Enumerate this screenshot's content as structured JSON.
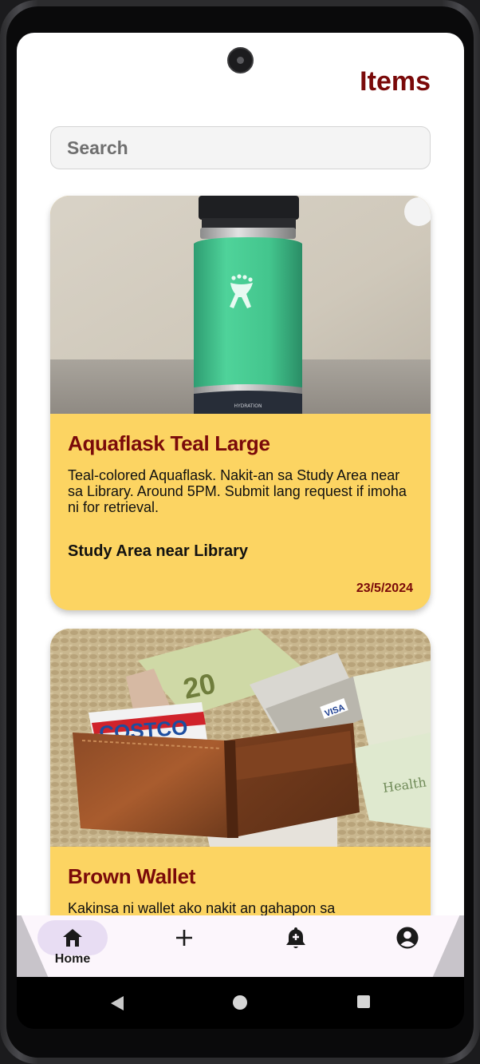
{
  "header": {
    "title": "Items"
  },
  "search": {
    "placeholder": "Search"
  },
  "items": [
    {
      "title": "Aquaflask Teal Large",
      "description": "Teal-colored Aquaflask. Nakit-an sa Study Area near sa Library. Around 5PM. Submit lang request if imoha ni for retrieval.",
      "location": "Study Area near Library",
      "date": "23/5/2024",
      "image": "teal-water-bottle-photo"
    },
    {
      "title": "Brown Wallet",
      "description": "Kakinsa ni wallet ako nakit an gahapon sa",
      "image": "brown-wallet-photo",
      "image_text": {
        "card": "COSTCO",
        "bill": "20",
        "credit_card": "VISA",
        "health_card": "Health"
      }
    }
  ],
  "bottom_nav": {
    "items": [
      {
        "label": "Home",
        "icon": "home-icon",
        "active": true
      },
      {
        "label": "",
        "icon": "plus-icon"
      },
      {
        "label": "",
        "icon": "bell-plus-icon"
      },
      {
        "label": "",
        "icon": "account-circle-icon"
      }
    ]
  },
  "colors": {
    "accent": "#7a0a0a",
    "card_background": "#fcd462",
    "nav_background": "#fcf6fc",
    "nav_active_pill": "#e8ddf3"
  }
}
